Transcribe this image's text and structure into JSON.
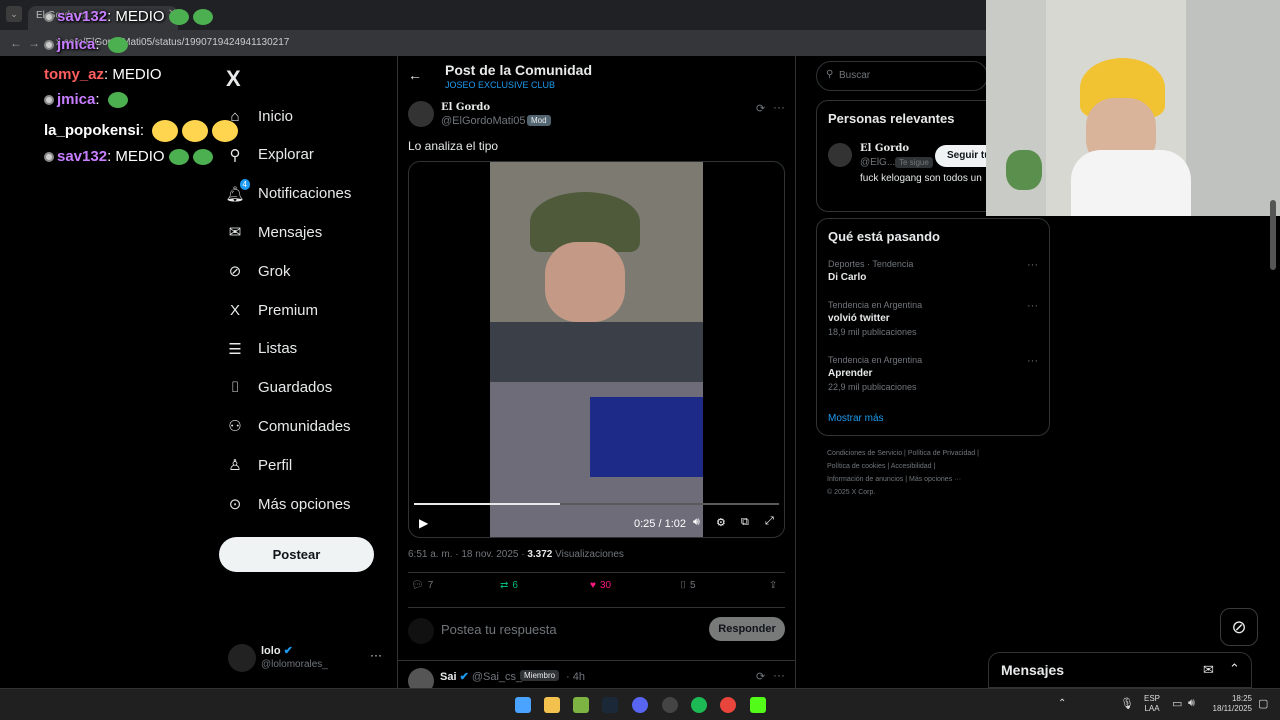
{
  "browser": {
    "tab_title": "El Gordo en X",
    "url": "x.com/ElGordoMati05/status/1990719424941130217"
  },
  "chat": [
    {
      "user": "sav132",
      "text": "MEDIO",
      "color": "#c77dff",
      "emotes": 2
    },
    {
      "user": "jmica",
      "text": "",
      "color": "#c77dff",
      "emotes": 1
    },
    {
      "user": "tomy_az",
      "text": "MEDIO",
      "color": "#ff5e5e",
      "emotes": 0
    },
    {
      "user": "jmica",
      "text": "",
      "color": "#c77dff",
      "emotes": 1
    },
    {
      "user": "la_popokensi",
      "text": "",
      "color": "#ffffff",
      "emotes": 3
    },
    {
      "user": "sav132",
      "text": "MEDIO",
      "color": "#c77dff",
      "emotes": 2
    }
  ],
  "sidebar": {
    "logo": "X",
    "items": [
      {
        "label": "Inicio",
        "icon": "home-icon",
        "glyph": "⌂"
      },
      {
        "label": "Explorar",
        "icon": "search-icon",
        "glyph": "⚲"
      },
      {
        "label": "Notificaciones",
        "icon": "bell-icon",
        "glyph": "🔔︎",
        "badge": "4"
      },
      {
        "label": "Mensajes",
        "icon": "mail-icon",
        "glyph": "✉"
      },
      {
        "label": "Grok",
        "icon": "grok-icon",
        "glyph": "⊘"
      },
      {
        "label": "Premium",
        "icon": "x-premium-icon",
        "glyph": "X"
      },
      {
        "label": "Listas",
        "icon": "list-icon",
        "glyph": "☰"
      },
      {
        "label": "Guardados",
        "icon": "bookmark-icon",
        "glyph": "⌷"
      },
      {
        "label": "Comunidades",
        "icon": "communities-icon",
        "glyph": "⚇"
      },
      {
        "label": "Perfil",
        "icon": "profile-icon",
        "glyph": "♙"
      },
      {
        "label": "Más opciones",
        "icon": "more-icon",
        "glyph": "⊙"
      }
    ],
    "post_button": "Postear",
    "account": {
      "name": "lolo",
      "handle": "@lolomorales_",
      "more": "···"
    }
  },
  "post": {
    "header_title": "Post de la Comunidad",
    "community": "JOSEO EXCLUSIVE CLUB",
    "author_name": "El Gordo",
    "author_handle": "@ElGordoMati05",
    "role": "Mod",
    "text": "Lo analiza el tipo",
    "video": {
      "time": "0:25 / 1:02",
      "progress": 0.4
    },
    "timestamp": "6:51 a. m. · 18 nov. 2025 · ",
    "views_count": "3.372",
    "views_label": "Visualizaciones",
    "replies": "7",
    "reposts": "6",
    "likes": "30",
    "bookmarks": "5",
    "reply_placeholder": "Postea tu respuesta",
    "reply_button": "Responder"
  },
  "next_reply": {
    "name": "Sai",
    "handle": "@Sai_cs_",
    "role": "Miembro",
    "time": "· 4h"
  },
  "right": {
    "search_placeholder": "Buscar",
    "relevant_title": "Personas relevantes",
    "relevant": {
      "name": "El Gordo",
      "handle": "@ElG...",
      "follows": "Te sigue",
      "follow_btn": "Seguir tú",
      "bio": "fuck kelogang son todos un"
    },
    "trending_title": "Qué está pasando",
    "trends": [
      {
        "cat": "Deportes · Tendencia",
        "name": "Di Carlo",
        "count": ""
      },
      {
        "cat": "Tendencia en Argentina",
        "name": "volvió twitter",
        "count": "18,9 mil publicaciones"
      },
      {
        "cat": "Tendencia en Argentina",
        "name": "Aprender",
        "count": "22,9 mil publicaciones"
      }
    ],
    "show_more": "Mostrar más",
    "footer": [
      "Condiciones de Servicio",
      "Política de Privacidad",
      "Política de cookies",
      "Accesibilidad",
      "Información de anuncios",
      "Más opciones ···",
      "© 2025 X Corp."
    ]
  },
  "messages_dock": {
    "title": "Mensajes"
  },
  "taskbar": {
    "lang": "ESP",
    "layout": "LAA",
    "time": "18:25",
    "date": "18/11/2025"
  }
}
